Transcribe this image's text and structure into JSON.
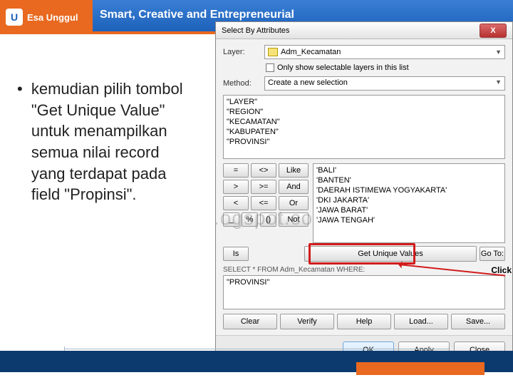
{
  "header": {
    "logo": "Esa Unggul",
    "logo_initial": "U",
    "title": "Smart, Creative and Entrepreneurial"
  },
  "instruction": {
    "bullet": "•",
    "text": "kemudian pilih tombol \"Get Unique Value\" untuk menampilkan semua nilai record yang terdapat pada field \"Propinsi\"."
  },
  "dialog": {
    "title": "Select By Attributes",
    "close": "X",
    "layer_label": "Layer:",
    "layer_value": "Adm_Kecamatan",
    "only_selectable": "Only show selectable layers in this list",
    "method_label": "Method:",
    "method_value": "Create a new selection",
    "fields": [
      "\"LAYER\"",
      "\"REGION\"",
      "\"KECAMATAN\"",
      "\"KABUPATEN\"",
      "\"PROVINSI\""
    ],
    "operators": {
      "r1": [
        "=",
        "<>",
        "Like"
      ],
      "r2": [
        ">",
        ">=",
        "And"
      ],
      "r3": [
        "<",
        "<=",
        "Or"
      ],
      "r4": [
        "_",
        "%",
        "()",
        "Not"
      ]
    },
    "values": [
      "'BALI'",
      "'BANTEN'",
      "'DAERAH ISTIMEWA YOGYAKARTA'",
      "'DKI JAKARTA'",
      "'JAWA BARAT'",
      "'JAWA TENGAH'"
    ],
    "is_btn": "Is",
    "get_unique": "Get Unique Values",
    "goto": "Go To:",
    "sql_label": "SELECT * FROM Adm_Kecamatan WHERE:",
    "sql_text": "\"PROVINSI\"",
    "bottom": [
      "Clear",
      "Verify",
      "Help",
      "Load...",
      "Save..."
    ],
    "footer": {
      "ok": "OK",
      "apply": "Apply",
      "close": "Close"
    }
  },
  "watermark": ".ogspot.co",
  "click_label": "Click"
}
